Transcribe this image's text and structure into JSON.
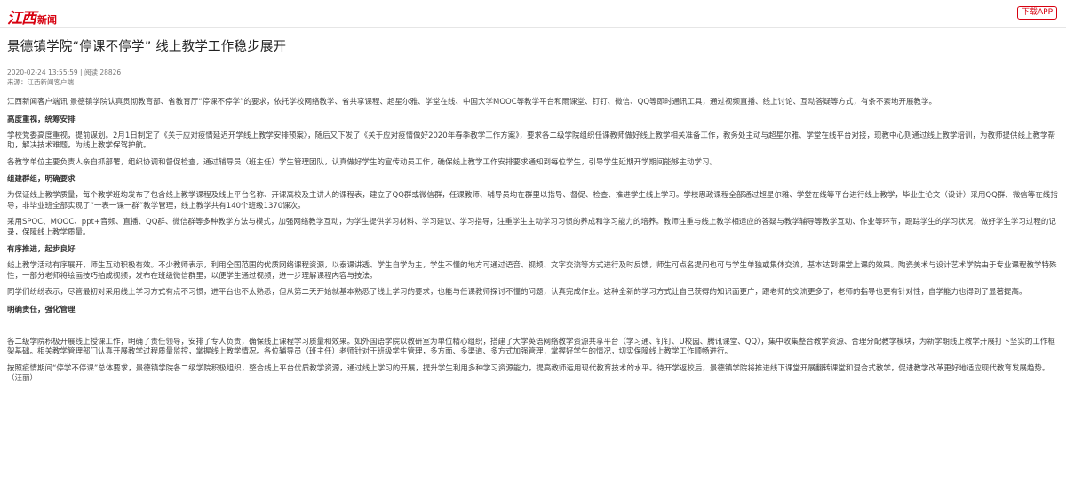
{
  "header": {
    "logo_mark": "江西",
    "logo_sub": "新闻",
    "download_label": "下载APP"
  },
  "article": {
    "title": "景德镇学院“停课不停学” 线上教学工作稳步展开",
    "meta_line": "2020-02-24 13:55:59 | 阅读 28826",
    "source_line": "来源：江西新闻客户端",
    "paragraphs": [
      "江西新闻客户端讯 景德镇学院认真贯彻教育部、省教育厅“停课不停学”的要求，依托学校网络教学、省共享课程、超星尔雅、学堂在线、中国大学MOOC等教学平台和雨课堂、钉钉、微信、QQ等即时通讯工具，通过视频直播、线上讨论、互动答疑等方式，有条不紊地开展教学。",
      "学校党委高度重视，提前谋划。2月1日制定了《关于应对疫情延迟开学线上教学安排预案》，随后又下发了《关于应对疫情做好2020年春季教学工作方案》，要求各二级学院组织任课教师做好线上教学相关准备工作，教务处主动与超星尔雅、学堂在线平台对接，现教中心则通过线上教学培训，为教师提供线上教学帮助，解决技术难题，为线上教学保驾护航。",
      "各教学单位主要负责人亲自抓部署，组织协调和督促检查，通过辅导员（班主任）学生管理团队，认真做好学生的宣传动员工作，确保线上教学工作安排要求通知到每位学生，引导学生延期开学期间能够主动学习。",
      "为保证线上教学质量，每个教学班均发布了包含线上教学课程及线上平台名称、开课高校及主讲人的课程表，建立了QQ群或微信群，任课教师、辅导员均在群里以指导、督促、检查、推进学生线上学习。学校思政课程全部通过超星尔雅、学堂在线等平台进行线上教学，毕业生论文（设计）采用QQ群、微信等在线指导，非毕业班全部实现了“一表一课一群”教学管理，线上教学共有140个班级1370课次。",
      "采用SPOC、MOOC、ppt+音频、直播、QQ群、微信群等多种教学方法与模式，加强网络教学互动，为学生提供学习材料、学习建议、学习指导，注重学生主动学习习惯的养成和学习能力的培养。教师注重与线上教学相适应的答疑与教学辅导等教学互动、作业等环节，跟踪学生的学习状况，做好学生学习过程的记录，保障线上教学质量。",
      "线上教学活动有序展开，师生互动积极有效。不少教师表示，利用全国范围的优质网络课程资源，以泰课讲透、学生自学为主，学生不懂的地方可通过语音、视频、文字交流等方式进行及时反馈，师生可点名提问也可与学生单独或集体交流，基本达到课堂上课的效果。陶瓷美术与设计艺术学院由于专业课程教学特殊性，一部分老师将绘画技巧拍成视频，发布在班级微信群里，以便学生通过视频，进一步理解课程内容与技法。",
      "同学们纷纷表示，尽管最初对采用线上学习方式有点不习惯，进平台也不太熟悉，但从第二天开始就基本熟悉了线上学习的要求，也能与任课教师探讨不懂的问题，认真完成作业。这种全新的学习方式让自己获得的知识面更广，跟老师的交流更多了，老师的指导也更有针对性，自学能力也得到了显著提高。",
      "各二级学院积极开展线上授课工作，明确了责任领导，安排了专人负责，确保线上课程学习质量和效果。如外国语学院以教研室为单位精心组织，搭建了大学英语网络教学资源共享平台（学习通、钉钉、U校园、腾讯课堂、QQ），集中收集整合教学资源、合理分配教学模块，为新学期线上教学开展打下坚实的工作框架基础。相关教学管理部门认真开展教学过程质量监控，掌握线上教学情况。各位辅导员（班主任）老师针对于班级学生管理，多方面、多渠道、多方式加强管理，掌握好学生的情况，切实保障线上教学工作顺畅进行。",
      "按照疫情期间“停学不停课”总体要求，景德镇学院各二级学院积极组织，整合线上平台优质教学资源，通过线上学习的开展，提升学生利用多种学习资源能力，提高教师运用现代教育技术的水平。待开学返校后，景德镇学院将推进线下课堂开展翻转课堂和混合式教学，促进教学改革更好地适应现代教育发展趋势。（汪丽）"
    ],
    "headings": [
      "高度重视，统筹安排",
      "组建群组，明确要求",
      "有序推进，起步良好",
      "明确责任，强化管理"
    ]
  }
}
